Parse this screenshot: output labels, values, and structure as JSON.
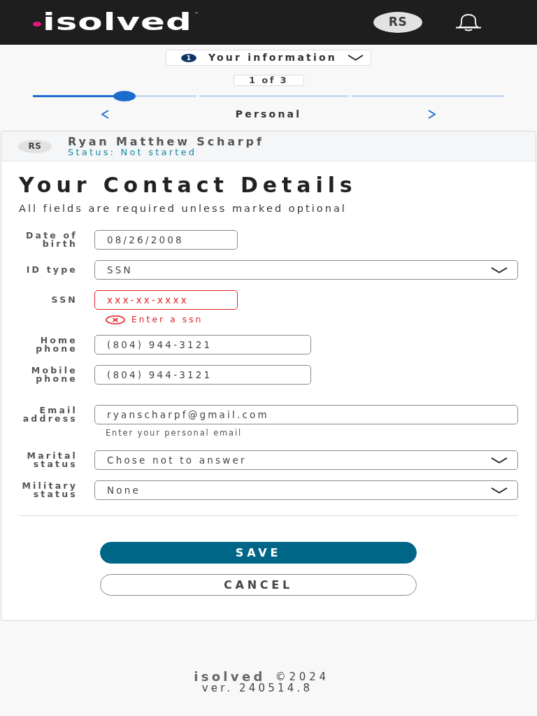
{
  "header": {
    "logo": {
      "text": "isolved",
      "trademark": "™"
    },
    "avatar": "RS"
  },
  "step_selector": {
    "number": "1",
    "label": "Your information"
  },
  "progress": {
    "counter": "1 of 3",
    "level": 0.195,
    "step_label": "Personal"
  },
  "profile": {
    "initials": "RS",
    "name": "Ryan Matthew Scharpf",
    "status": "Status: Not started"
  },
  "form": {
    "title": "Your Contact Details",
    "subtitle": "All fields are required unless marked optional",
    "fields": [
      {
        "kind": "date",
        "label": "Date of birth",
        "value": "08/26/2008",
        "invalid": false
      },
      {
        "kind": "select",
        "label": "ID type",
        "value": "SSN",
        "invalid": false
      },
      {
        "kind": "ssn",
        "label": "SSN",
        "placeholder": "xxx-xx-xxxx",
        "invalid": true,
        "error": "Enter a ssn"
      },
      {
        "kind": "phone",
        "label": "Home phone",
        "value": "(804) 944-3121",
        "invalid": false
      },
      {
        "kind": "phone",
        "label": "Mobile phone",
        "value": "(804) 944-3121",
        "invalid": false
      },
      {
        "kind": "email",
        "label": "Email address",
        "value": "ryanscharpf@gmail.com",
        "invalid": false,
        "help": "Enter your personal email"
      },
      {
        "kind": "select",
        "label": "Marital status",
        "value": "Chose not to answer",
        "invalid": false
      },
      {
        "kind": "select",
        "label": "Military status",
        "value": "None",
        "invalid": false
      }
    ]
  },
  "actions": [
    {
      "kind": "primary",
      "label": "SAVE"
    },
    {
      "kind": "secondary",
      "label": "CANCEL"
    }
  ],
  "footer": {
    "logo": "isolved",
    "copyright": "©2024",
    "version": "ver. 240514.8"
  }
}
